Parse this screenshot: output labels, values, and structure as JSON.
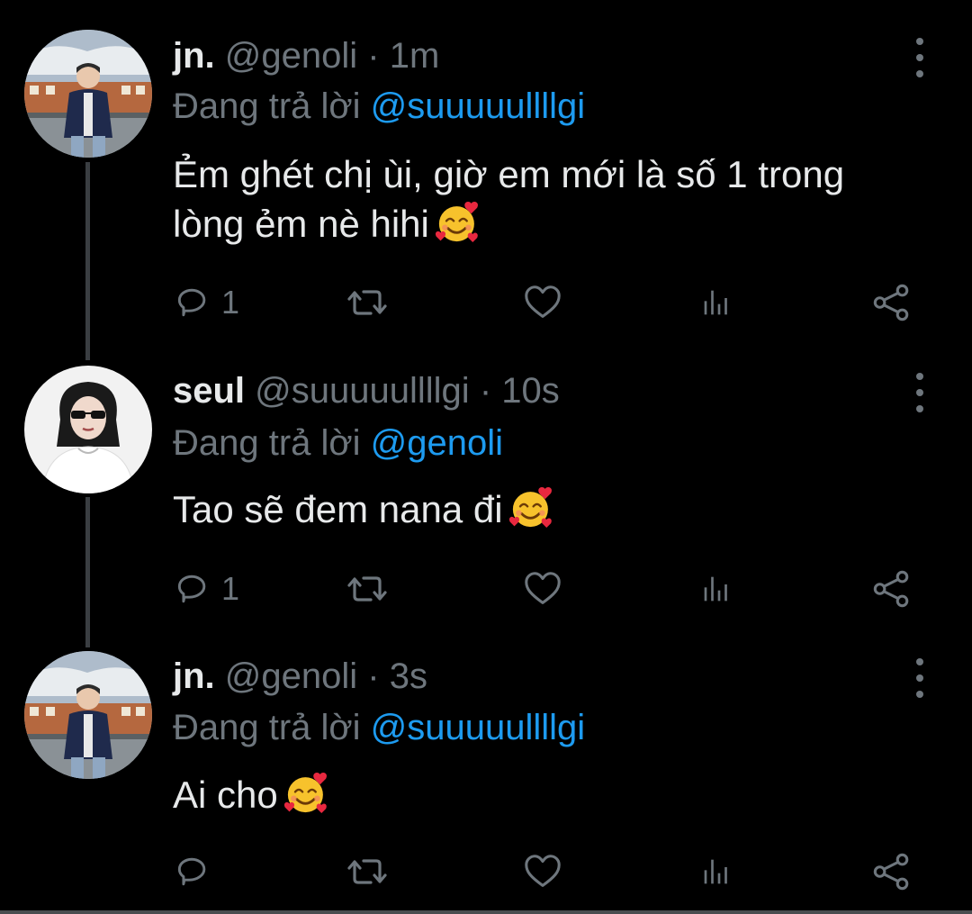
{
  "tweets": [
    {
      "display_name": "jn.",
      "handle": "@genoli",
      "separator": "·",
      "time": "1m",
      "reply_prefix": "Đang trả lời",
      "reply_to": "@suuuuullllgi",
      "text_line1": "Ẻm ghét chị ùi, giờ em mới là số 1 trong",
      "text_line2": "lòng ẻm nè hihi",
      "emoji": "smiling-face-with-hearts",
      "reply_count": "1",
      "avatar": "profile-photo-boy-in-varsity-jacket"
    },
    {
      "display_name": "seul",
      "handle": "@suuuuullllgi",
      "separator": "·",
      "time": "10s",
      "reply_prefix": "Đang trả lời",
      "reply_to": "@genoli",
      "text_line1": "Tao sẽ đem nana đi",
      "emoji": "smiling-face-with-hearts",
      "reply_count": "1",
      "avatar": "profile-photo-girl-in-sunglasses"
    },
    {
      "display_name": "jn.",
      "handle": "@genoli",
      "separator": "·",
      "time": "3s",
      "reply_prefix": "Đang trả lời",
      "reply_to": "@suuuuullllgi",
      "text_line1": "Ai cho",
      "emoji": "smiling-face-with-hearts",
      "reply_count": "",
      "avatar": "profile-photo-boy-in-varsity-jacket"
    }
  ],
  "icons": {
    "reply": "reply-icon",
    "retweet": "retweet-icon",
    "like": "heart-icon",
    "analytics": "analytics-icon",
    "share": "share-icon",
    "more": "more-vertical-icon"
  },
  "colors": {
    "background": "#000000",
    "primary_text": "#e7e9ea",
    "secondary_text": "#6e767d",
    "link": "#1d9bf0",
    "thread_line": "#3a3e42"
  }
}
